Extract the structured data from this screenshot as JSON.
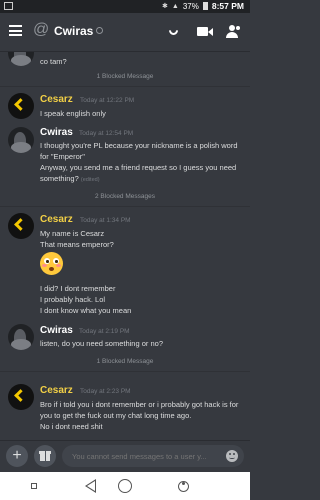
{
  "status_bar": {
    "battery": "37%",
    "time": "8:57 PM"
  },
  "header": {
    "title": "Cwiras",
    "at_symbol": "@"
  },
  "messages": {
    "top_fragment": "co tam?",
    "blocked_1": "1 Blocked Message",
    "group1": {
      "author": "Cesarz",
      "timestamp": "Today at 12:22 PM",
      "lines": [
        "I speak english only"
      ]
    },
    "group2": {
      "author": "Cwiras",
      "timestamp": "Today at 12:54 PM",
      "lines": [
        "I thought you're PL because your nickname is a polish word",
        "for \"Emperor\"",
        "Anyway, you send me a friend request so I guess you need",
        "something?"
      ],
      "edited": "(edited)"
    },
    "blocked_2": "2 Blocked Messages",
    "group3": {
      "author": "Cesarz",
      "timestamp": "Today at 1:34 PM",
      "lines": [
        "My name is Cesarz",
        "That means emperor?"
      ],
      "after_emoji": [
        "I did? I dont remember",
        "I probably hack. Lol",
        "I dont know what you mean"
      ]
    },
    "group4": {
      "author": "Cwiras",
      "timestamp": "Today at 2:19 PM",
      "lines": [
        "listen, do you need something or no?"
      ]
    },
    "blocked_3": "1 Blocked Message",
    "group5": {
      "author": "Cesarz",
      "timestamp": "Today at 2:23 PM",
      "lines": [
        "Bro if i told you i dont remember or i probably got hack is for",
        "you to get the fuck out my chat long time ago.",
        "No i dont need shit"
      ]
    }
  },
  "input": {
    "placeholder": "You cannot send messages to a user y..."
  },
  "colors": {
    "cesarz_name": "#f2d046",
    "background": "#36393f"
  },
  "icons": [
    "hamburger-icon",
    "call-icon",
    "video-icon",
    "members-icon",
    "plus-icon",
    "gift-icon",
    "emoji-icon"
  ]
}
